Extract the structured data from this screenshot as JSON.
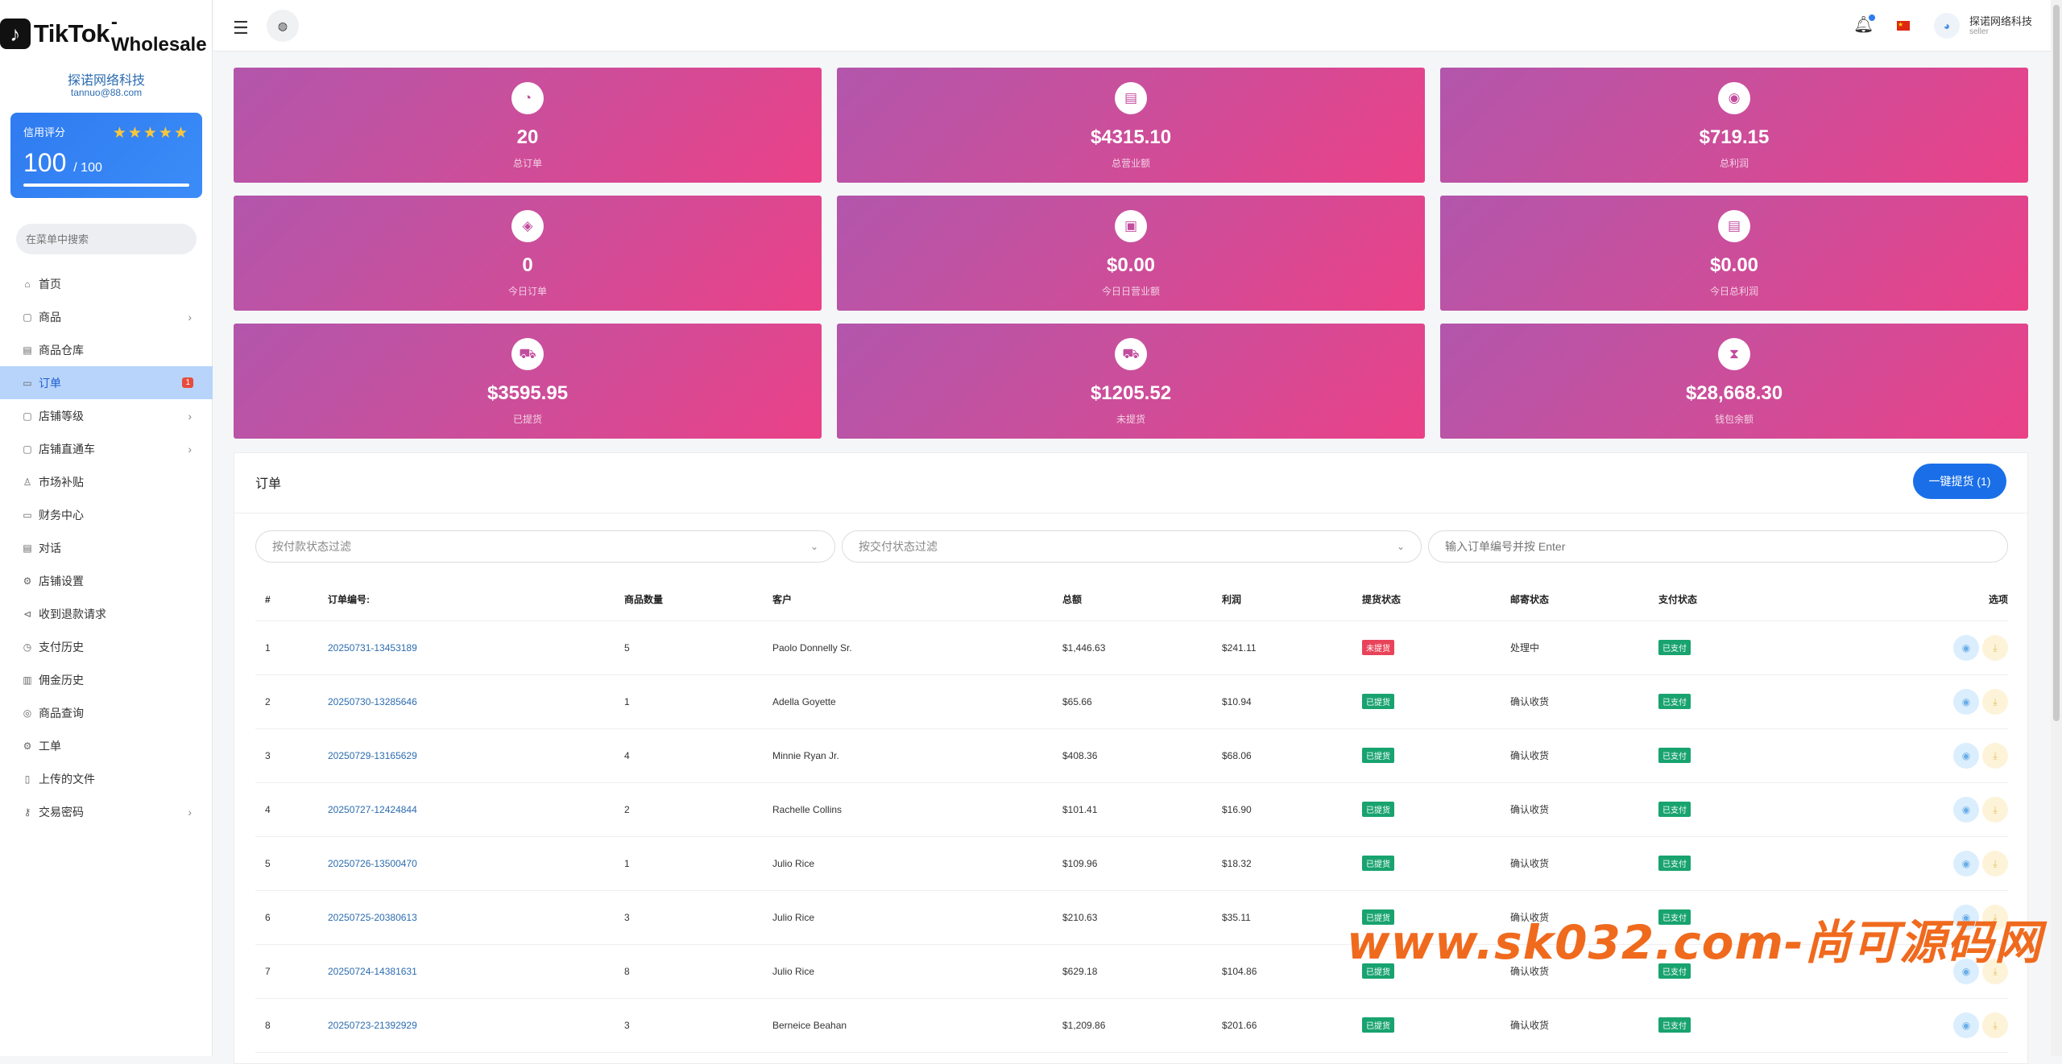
{
  "brand": {
    "name": "TikTok",
    "suffix": "-Wholesale",
    "mark": "♪"
  },
  "shop": {
    "name": "探诺网络科技",
    "email": "tannuo@88.com"
  },
  "credit": {
    "label": "信用评分",
    "score": "100",
    "max": "/ 100",
    "stars": "★★★★★"
  },
  "menu_search": {
    "placeholder": "在菜单中搜索"
  },
  "nav": [
    {
      "label": "首页",
      "icon": "⌂",
      "has_chevron": false
    },
    {
      "label": "商品",
      "icon": "▢",
      "has_chevron": true
    },
    {
      "label": "商品仓库",
      "icon": "▤",
      "has_chevron": false
    },
    {
      "label": "订单",
      "icon": "▭",
      "has_chevron": false,
      "active": true,
      "badge": "1"
    },
    {
      "label": "店铺等级",
      "icon": "▢",
      "has_chevron": true
    },
    {
      "label": "店铺直通车",
      "icon": "▢",
      "has_chevron": true
    },
    {
      "label": "市场补贴",
      "icon": "♙",
      "has_chevron": false
    },
    {
      "label": "财务中心",
      "icon": "▭",
      "has_chevron": false
    },
    {
      "label": "对话",
      "icon": "▤",
      "has_chevron": false
    },
    {
      "label": "店铺设置",
      "icon": "⚙",
      "has_chevron": false
    },
    {
      "label": "收到退款请求",
      "icon": "⊲",
      "has_chevron": false
    },
    {
      "label": "支付历史",
      "icon": "◷",
      "has_chevron": false
    },
    {
      "label": "佣金历史",
      "icon": "▥",
      "has_chevron": false
    },
    {
      "label": "商品查询",
      "icon": "◎",
      "has_chevron": false
    },
    {
      "label": "工单",
      "icon": "⚙",
      "has_chevron": false
    },
    {
      "label": "上传的文件",
      "icon": "▯",
      "has_chevron": false
    },
    {
      "label": "交易密码",
      "icon": "⚷",
      "has_chevron": true
    }
  ],
  "topbar": {
    "user_name": "探诺网络科技",
    "user_role": "seller"
  },
  "stats": [
    {
      "value": "20",
      "label": "总订单",
      "icon": "◔"
    },
    {
      "value": "$4315.10",
      "label": "总营业额",
      "icon": "▤"
    },
    {
      "value": "$719.15",
      "label": "总利润",
      "icon": "◉"
    },
    {
      "value": "0",
      "label": "今日订单",
      "icon": "◈"
    },
    {
      "value": "$0.00",
      "label": "今日日营业额",
      "icon": "▣"
    },
    {
      "value": "$0.00",
      "label": "今日总利润",
      "icon": "▤"
    },
    {
      "value": "$3595.95",
      "label": "已提货",
      "icon": "⛟"
    },
    {
      "value": "$1205.52",
      "label": "未提货",
      "icon": "⛟"
    },
    {
      "value": "$28,668.30",
      "label": "钱包余额",
      "icon": "⧗"
    }
  ],
  "orders": {
    "title": "订单",
    "bulk_button": "一键提货 (1)",
    "filter_payment": "按付款状态过滤",
    "filter_delivery": "按交付状态过滤",
    "search_placeholder": "输入订单编号并按 Enter",
    "columns": [
      "#",
      "订单编号:",
      "商品数量",
      "客户",
      "总额",
      "利润",
      "提货状态",
      "邮寄状态",
      "支付状态",
      "选项"
    ],
    "rows": [
      {
        "n": "1",
        "code": "20250731-13453189",
        "qty": "5",
        "customer": "Paolo Donnelly Sr.",
        "total": "$1,446.63",
        "profit": "$241.11",
        "pickup": "未提货",
        "pickup_state": "red",
        "mail": "处理中",
        "pay": "已支付"
      },
      {
        "n": "2",
        "code": "20250730-13285646",
        "qty": "1",
        "customer": "Adella Goyette",
        "total": "$65.66",
        "profit": "$10.94",
        "pickup": "已提货",
        "pickup_state": "green",
        "mail": "确认收货",
        "pay": "已支付"
      },
      {
        "n": "3",
        "code": "20250729-13165629",
        "qty": "4",
        "customer": "Minnie Ryan Jr.",
        "total": "$408.36",
        "profit": "$68.06",
        "pickup": "已提货",
        "pickup_state": "green",
        "mail": "确认收货",
        "pay": "已支付"
      },
      {
        "n": "4",
        "code": "20250727-12424844",
        "qty": "2",
        "customer": "Rachelle Collins",
        "total": "$101.41",
        "profit": "$16.90",
        "pickup": "已提货",
        "pickup_state": "green",
        "mail": "确认收货",
        "pay": "已支付"
      },
      {
        "n": "5",
        "code": "20250726-13500470",
        "qty": "1",
        "customer": "Julio Rice",
        "total": "$109.96",
        "profit": "$18.32",
        "pickup": "已提货",
        "pickup_state": "green",
        "mail": "确认收货",
        "pay": "已支付"
      },
      {
        "n": "6",
        "code": "20250725-20380613",
        "qty": "3",
        "customer": "Julio Rice",
        "total": "$210.63",
        "profit": "$35.11",
        "pickup": "已提货",
        "pickup_state": "green",
        "mail": "确认收货",
        "pay": "已支付"
      },
      {
        "n": "7",
        "code": "20250724-14381631",
        "qty": "8",
        "customer": "Julio Rice",
        "total": "$629.18",
        "profit": "$104.86",
        "pickup": "已提货",
        "pickup_state": "green",
        "mail": "确认收货",
        "pay": "已支付"
      },
      {
        "n": "8",
        "code": "20250723-21392929",
        "qty": "3",
        "customer": "Berneice Beahan",
        "total": "$1,209.86",
        "profit": "$201.66",
        "pickup": "已提货",
        "pickup_state": "green",
        "mail": "确认收货",
        "pay": "已支付"
      }
    ]
  },
  "watermark": "www.sk032.com-尚可源码网",
  "colors": {
    "accent": "#1a6fe8",
    "card_start": "#b256ac",
    "card_end": "#ea4188",
    "tag_red": "#e9435a",
    "tag_green": "#18a36f"
  }
}
